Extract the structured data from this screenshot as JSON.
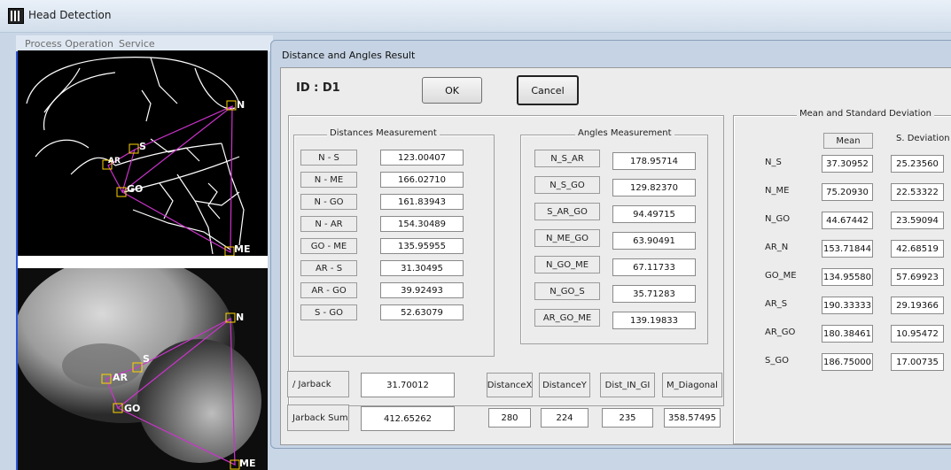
{
  "window": {
    "title": "Head Detection"
  },
  "menu": [
    "Process Operation",
    "Service"
  ],
  "landmarks_top": [
    "N",
    "S",
    "AR",
    "GO",
    "ME"
  ],
  "landmarks_bottom": [
    "N",
    "S",
    "AR",
    "GO",
    "ME"
  ],
  "dialog": {
    "title": "Distance and Angles Result",
    "id_label": "ID : D1",
    "ok_label": "OK",
    "cancel_label": "Cancel"
  },
  "distances": {
    "group_title": "Distances Measurement",
    "rows": [
      {
        "label": "N - S",
        "value": "123.00407"
      },
      {
        "label": "N - ME",
        "value": "166.02710"
      },
      {
        "label": "N - GO",
        "value": "161.83943"
      },
      {
        "label": "N - AR",
        "value": "154.30489"
      },
      {
        "label": "GO - ME",
        "value": "135.95955"
      },
      {
        "label": "AR - S",
        "value": "31.30495"
      },
      {
        "label": "AR - GO",
        "value": "39.92493"
      },
      {
        "label": "S - GO",
        "value": "52.63079"
      }
    ]
  },
  "angles": {
    "group_title": "Angles Measurement",
    "rows": [
      {
        "label": "N_S_AR",
        "value": "178.95714"
      },
      {
        "label": "N_S_GO",
        "value": "129.82370"
      },
      {
        "label": "S_AR_GO",
        "value": "94.49715"
      },
      {
        "label": "N_ME_GO",
        "value": "63.90491"
      },
      {
        "label": "N_GO_ME",
        "value": "67.11733"
      },
      {
        "label": "N_GO_S",
        "value": "35.71283"
      },
      {
        "label": "AR_GO_ME",
        "value": "139.19833"
      }
    ]
  },
  "stats": {
    "group_title": "Mean and Standard Deviation",
    "mean_header": "Mean",
    "sd_header": "S. Deviation",
    "rows": [
      {
        "label": "N_S",
        "mean": "37.30952",
        "sd": "25.23560"
      },
      {
        "label": "N_ME",
        "mean": "75.20930",
        "sd": "22.53322"
      },
      {
        "label": "N_GO",
        "mean": "44.67442",
        "sd": "23.59094"
      },
      {
        "label": "AR_N",
        "mean": "153.71844",
        "sd": "42.68519"
      },
      {
        "label": "GO_ME",
        "mean": "134.95580",
        "sd": "57.69923"
      },
      {
        "label": "AR_S",
        "mean": "190.33333",
        "sd": "29.19366"
      },
      {
        "label": "AR_GO",
        "mean": "180.38461",
        "sd": "10.95472"
      },
      {
        "label": "S_GO",
        "mean": "186.75000",
        "sd": "17.00735"
      }
    ]
  },
  "jarback": {
    "ratio_label": "/ Jarback",
    "ratio_value": "31.70012",
    "sum_label": "Jarback Sum",
    "sum_value": "412.65262"
  },
  "extras": [
    {
      "label": "DistanceX",
      "value": "280"
    },
    {
      "label": "DistanceY",
      "value": "224"
    },
    {
      "label": "Dist_IN_GI",
      "value": "235"
    },
    {
      "label": "M_Diagonal",
      "value": "358.57495"
    }
  ],
  "colors": {
    "landmark_box": "#ffd400",
    "trace_line": "#cc33cc",
    "titlebar": "#dfe8f2",
    "frame_blue": "#2c55d6"
  }
}
